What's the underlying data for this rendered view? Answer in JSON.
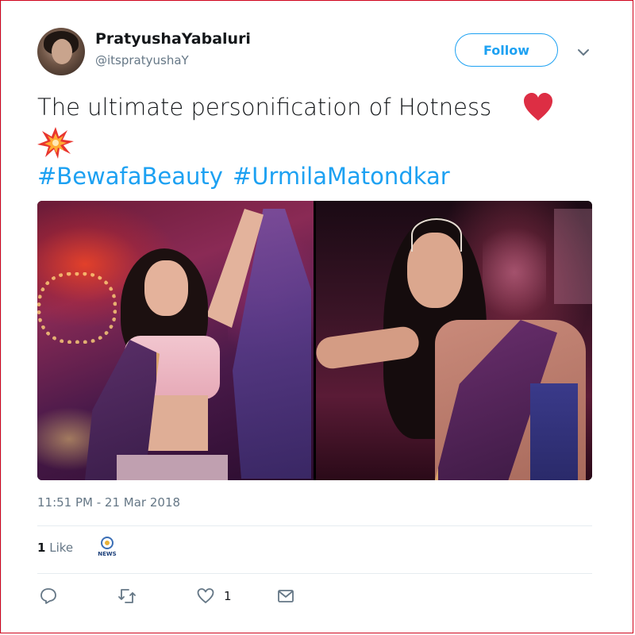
{
  "user": {
    "display_name": "PratyushaYabaluri",
    "handle": "@itspratyushaY"
  },
  "follow_button": {
    "label": "Follow"
  },
  "tweet": {
    "text": "The ultimate personification of Hotness",
    "emojis": [
      "heart-icon",
      "collision-icon"
    ],
    "hashtags": [
      "#BewafaBeauty",
      "#UrmilaMatondkar"
    ],
    "timestamp": "11:51 PM - 21 Mar 2018"
  },
  "stats": {
    "likes_count": "1",
    "likes_label": "Like"
  },
  "liker_badge": {
    "label": "NEWS"
  },
  "actions": {
    "reply_icon": "reply-icon",
    "retweet_icon": "retweet-icon",
    "like_icon": "heart-outline-icon",
    "like_count": "1",
    "dm_icon": "envelope-icon"
  },
  "colors": {
    "accent": "#1da1f2",
    "text": "#14171a",
    "muted": "#657786",
    "heart": "#e0245e",
    "border": "#d0021b"
  }
}
